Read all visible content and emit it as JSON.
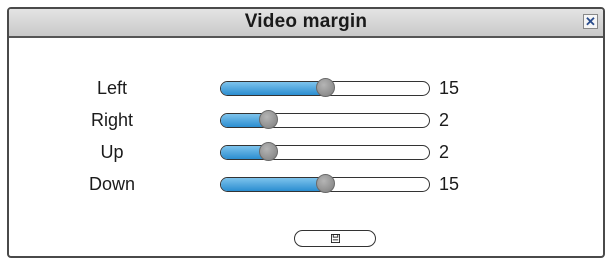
{
  "dialog": {
    "title": "Video margin",
    "close_icon": "close-icon"
  },
  "margins": [
    {
      "label": "Left",
      "value": "15",
      "fill_fraction": 0.5
    },
    {
      "label": "Right",
      "value": "2",
      "fill_fraction": 0.23
    },
    {
      "label": "Up",
      "value": "2",
      "fill_fraction": 0.23
    },
    {
      "label": "Down",
      "value": "15",
      "fill_fraction": 0.5
    }
  ],
  "save_button": {
    "icon": "save-icon"
  },
  "colors": {
    "slider_fill": "#2b8ed1",
    "slider_fill_light": "#7dc3ec",
    "thumb": "#7d7d7d",
    "titlebar": "#d0d0d0",
    "border": "#4a4a4a"
  }
}
